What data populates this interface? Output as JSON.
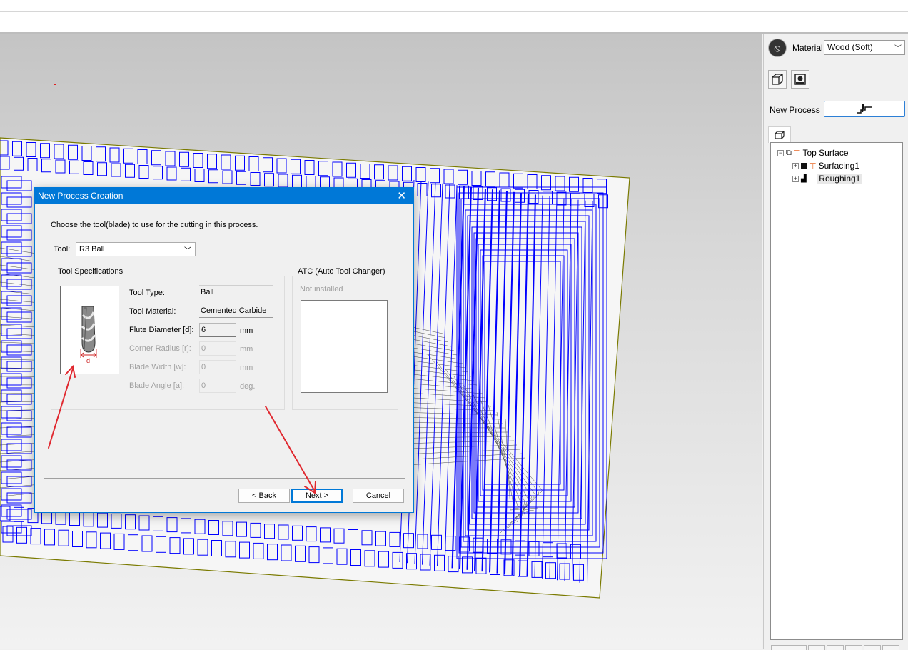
{
  "panel": {
    "material_label": "Material",
    "material_value": "Wood (Soft)",
    "new_process_label": "New Process",
    "tree": [
      {
        "label": "Top Surface",
        "level": 0,
        "expander": "−"
      },
      {
        "label": "Surfacing1",
        "level": 1,
        "expander": "+"
      },
      {
        "label": "Roughing1",
        "level": 1,
        "expander": "+",
        "selected": true
      }
    ]
  },
  "dialog": {
    "title": "New Process Creation",
    "instruction": "Choose the tool(blade) to use for the cutting in this process.",
    "tool_label": "Tool:",
    "tool_value": "R3 Ball",
    "specs_title": "Tool Specifications",
    "fields": {
      "tool_type": {
        "label": "Tool Type:",
        "value": "Ball"
      },
      "tool_material": {
        "label": "Tool Material:",
        "value": "Cemented Carbide"
      },
      "flute_diameter": {
        "label": "Flute Diameter [d]:",
        "value": "6",
        "unit": "mm"
      },
      "corner_radius": {
        "label": "Corner Radius [r]:",
        "value": "0",
        "unit": "mm"
      },
      "blade_width": {
        "label": "Blade Width [w]:",
        "value": "0",
        "unit": "mm"
      },
      "blade_angle": {
        "label": "Blade Angle [a]:",
        "value": "0",
        "unit": "deg."
      }
    },
    "image_dim_label": "d",
    "atc_title": "ATC (Auto Tool Changer)",
    "atc_status": "Not installed",
    "buttons": {
      "back": "< Back",
      "next": "Next >",
      "cancel": "Cancel"
    }
  },
  "colors": {
    "accent": "#0078d7",
    "toolpath": "#0000ff",
    "annotation_arrow": "#e0282f"
  }
}
